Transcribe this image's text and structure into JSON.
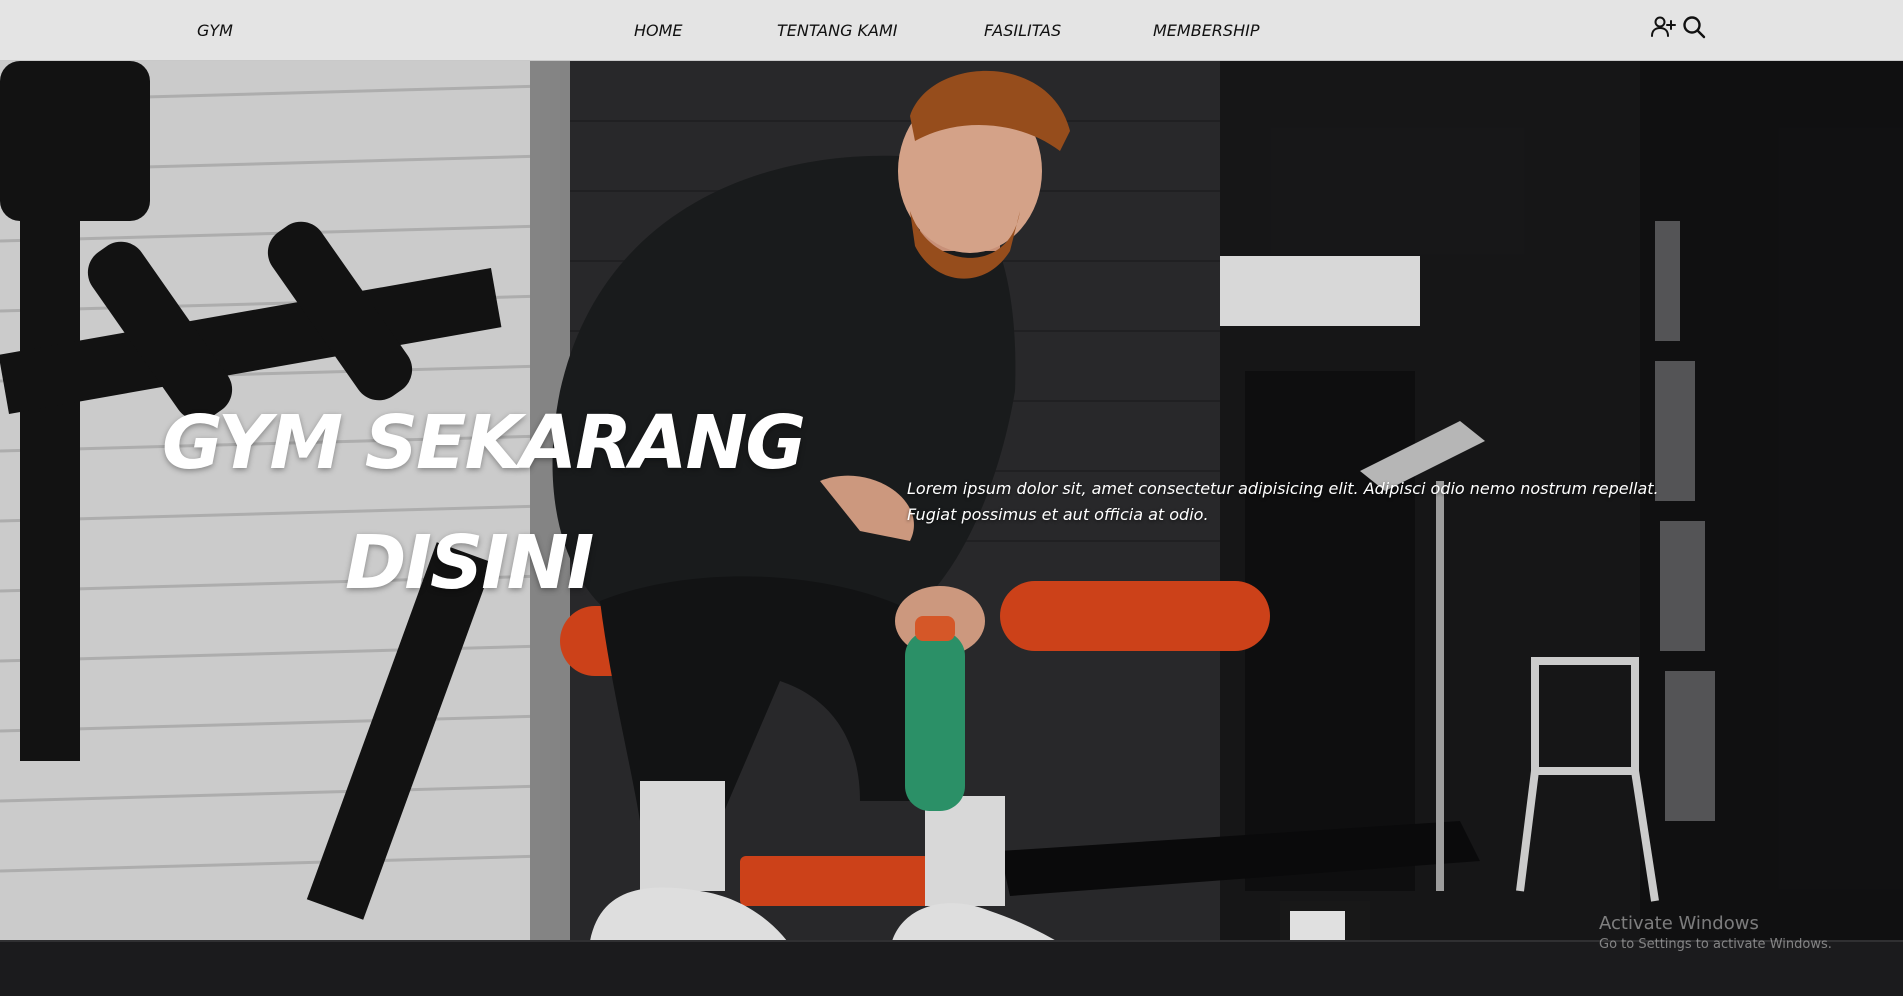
{
  "navbar": {
    "brand": "GYM",
    "links": [
      {
        "label": "HOME"
      },
      {
        "label": "TENTANG KAMI"
      },
      {
        "label": "FASILITAS"
      },
      {
        "label": "MEMBERSHIP"
      }
    ],
    "icons": [
      "user-plus-icon",
      "search-icon"
    ]
  },
  "hero": {
    "headline_line1": "GYM SEKARANG",
    "headline_line2": "DISINI",
    "subtext": "Lorem ipsum dolor sit, amet consectetur adipisicing elit. Adipisci odio nemo nostrum repellat. Fugiat possimus et aut officia at odio."
  },
  "watermark": {
    "title": "Activate Windows",
    "subtitle": "Go to Settings to activate Windows."
  },
  "colors": {
    "navbar_bg": "#e4e4e4",
    "text_dark": "#111111",
    "hero_text": "#ffffff",
    "accent_orange": "#d9461b",
    "bottle_green": "#2e9a6e"
  }
}
